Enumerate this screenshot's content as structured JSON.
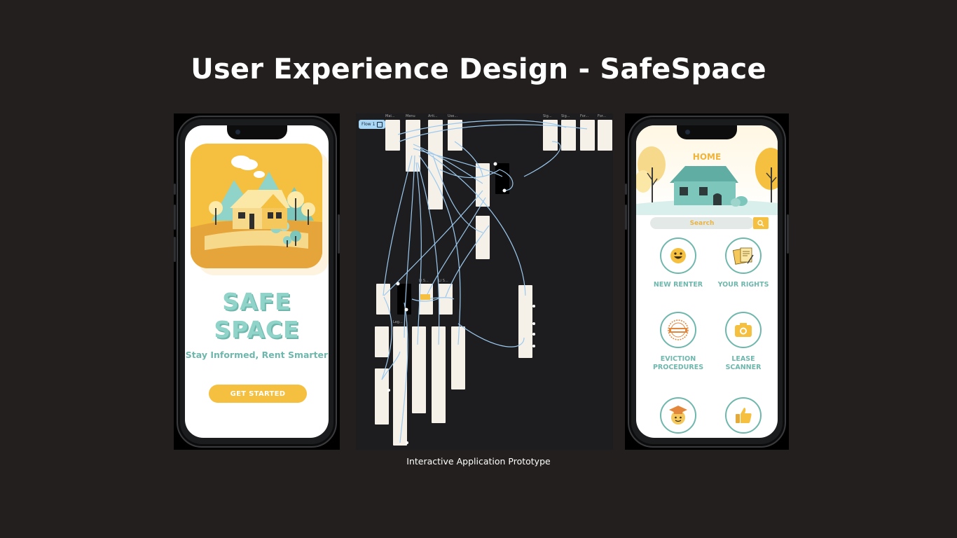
{
  "title": "User Experience Design - SafeSpace",
  "caption": "Interactive Application Prototype",
  "colors": {
    "background": "#231f1e",
    "brand_yellow": "#f5bf3f",
    "brand_teal": "#6fb7ad",
    "brand_teal_light": "#8fd3c9"
  },
  "splash": {
    "brand_line_1": "SAFE",
    "brand_line_2": "SPACE",
    "tagline": "Stay Informed, Rent Smarter",
    "cta_label": "GET STARTED",
    "art_icon": "house-landscape-illustration"
  },
  "prototype": {
    "flow_badge": "Flow 1",
    "frame_labels": {
      "main": "Mai...",
      "menu": "Menu",
      "arti": "Arti...",
      "use": "Use...",
      "sig1": "Sig...",
      "sig2": "Sig...",
      "for1": "For...",
      "for2": "For...",
      "leg": "Leg...",
      "ls1": "Li S...",
      "ls2": "Li S..."
    }
  },
  "home": {
    "title": "HOME",
    "search_placeholder": "Search",
    "tiles": [
      {
        "label": "NEW RENTER",
        "icon": "smiley-icon"
      },
      {
        "label": "YOUR RIGHTS",
        "icon": "documents-icon"
      },
      {
        "label": "EVICTION\nPROCEDURES",
        "icon": "eviction-stamp-icon"
      },
      {
        "label": "LEASE\nSCANNER",
        "icon": "camera-icon"
      },
      {
        "label": "",
        "icon": "graduate-icon"
      },
      {
        "label": "",
        "icon": "thumbs-up-icon"
      }
    ]
  }
}
